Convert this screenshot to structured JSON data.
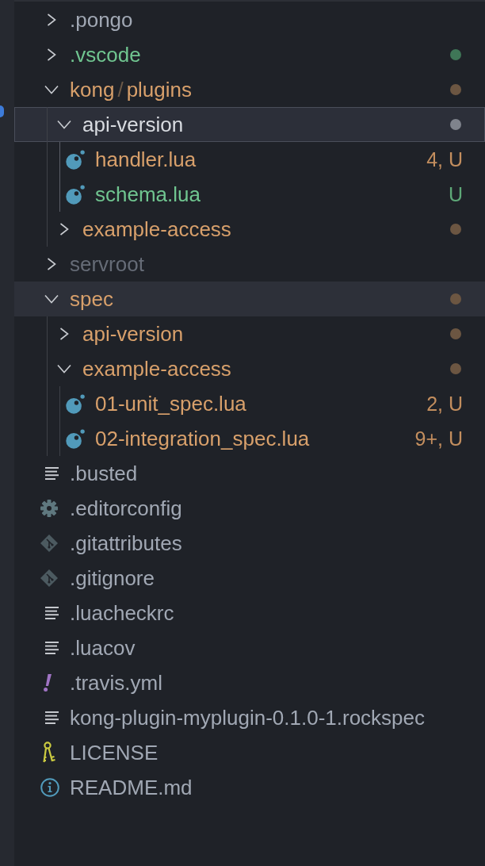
{
  "explorer": {
    "tree": [
      {
        "name": ".pongo",
        "kind": "folder",
        "expanded": false,
        "selected": false,
        "hovered": false,
        "color": "#a1a8b4"
      },
      {
        "name": ".vscode",
        "kind": "folder",
        "expanded": false,
        "selected": false,
        "hovered": false,
        "color": "#70c590",
        "decoration": {
          "kind": "dot",
          "color": "#3f7657"
        }
      },
      {
        "segments": [
          "kong",
          "plugins"
        ],
        "separator": "/",
        "kind": "folder",
        "expanded": true,
        "selected": false,
        "hovered": false,
        "color": "#d8a06b",
        "decoration": {
          "kind": "dot",
          "color": "#6c5642"
        },
        "children": [
          {
            "name": "api-version",
            "kind": "folder",
            "expanded": true,
            "selected": true,
            "hovered": false,
            "color": "#d8dbe0",
            "decoration": {
              "kind": "dot",
              "color": "#7f838c"
            },
            "children": [
              {
                "name": "handler.lua",
                "kind": "lua",
                "selected": false,
                "hovered": false,
                "color": "#d8a06b",
                "decoration": {
                  "kind": "badge",
                  "text": "4, U",
                  "color": "#c38e5e"
                }
              },
              {
                "name": "schema.lua",
                "kind": "lua",
                "selected": false,
                "hovered": false,
                "color": "#70c590",
                "decoration": {
                  "kind": "badge",
                  "text": "U",
                  "color": "#5ea878"
                }
              }
            ]
          },
          {
            "name": "example-access",
            "kind": "folder",
            "expanded": false,
            "selected": false,
            "hovered": false,
            "color": "#d8a06b",
            "decoration": {
              "kind": "dot",
              "color": "#6c5642"
            }
          }
        ]
      },
      {
        "name": "servroot",
        "kind": "folder",
        "expanded": false,
        "selected": false,
        "hovered": false,
        "color": "#666c77"
      },
      {
        "name": "spec",
        "kind": "folder",
        "expanded": true,
        "selected": false,
        "hovered": true,
        "color": "#d8a06b",
        "decoration": {
          "kind": "dot",
          "color": "#6c5642"
        },
        "children": [
          {
            "name": "api-version",
            "kind": "folder",
            "expanded": false,
            "selected": false,
            "hovered": false,
            "color": "#d8a06b",
            "decoration": {
              "kind": "dot",
              "color": "#6c5642"
            }
          },
          {
            "name": "example-access",
            "kind": "folder",
            "expanded": true,
            "selected": false,
            "hovered": false,
            "color": "#d8a06b",
            "decoration": {
              "kind": "dot",
              "color": "#6c5642"
            },
            "children": [
              {
                "name": "01-unit_spec.lua",
                "kind": "lua",
                "selected": false,
                "hovered": false,
                "color": "#d8a06b",
                "decoration": {
                  "kind": "badge",
                  "text": "2, U",
                  "color": "#c38e5e"
                }
              },
              {
                "name": "02-integration_spec.lua",
                "kind": "lua",
                "selected": false,
                "hovered": false,
                "color": "#d8a06b",
                "decoration": {
                  "kind": "badge",
                  "text": "9+, U",
                  "color": "#c38e5e"
                }
              }
            ]
          }
        ]
      },
      {
        "name": ".busted",
        "kind": "text",
        "selected": false,
        "hovered": false,
        "color": "#a1a8b4"
      },
      {
        "name": ".editorconfig",
        "kind": "config",
        "selected": false,
        "hovered": false,
        "color": "#a1a8b4"
      },
      {
        "name": ".gitattributes",
        "kind": "git",
        "selected": false,
        "hovered": false,
        "color": "#a1a8b4"
      },
      {
        "name": ".gitignore",
        "kind": "git",
        "selected": false,
        "hovered": false,
        "color": "#a1a8b4"
      },
      {
        "name": ".luacheckrc",
        "kind": "text",
        "selected": false,
        "hovered": false,
        "color": "#a1a8b4"
      },
      {
        "name": ".luacov",
        "kind": "text",
        "selected": false,
        "hovered": false,
        "color": "#a1a8b4"
      },
      {
        "name": ".travis.yml",
        "kind": "yaml",
        "selected": false,
        "hovered": false,
        "color": "#a1a8b4"
      },
      {
        "name": "kong-plugin-myplugin-0.1.0-1.rockspec",
        "kind": "text",
        "selected": false,
        "hovered": false,
        "color": "#a1a8b4"
      },
      {
        "name": "LICENSE",
        "kind": "license",
        "selected": false,
        "hovered": false,
        "color": "#a1a8b4"
      },
      {
        "name": "README.md",
        "kind": "readme",
        "selected": false,
        "hovered": false,
        "color": "#a1a8b4"
      }
    ]
  }
}
